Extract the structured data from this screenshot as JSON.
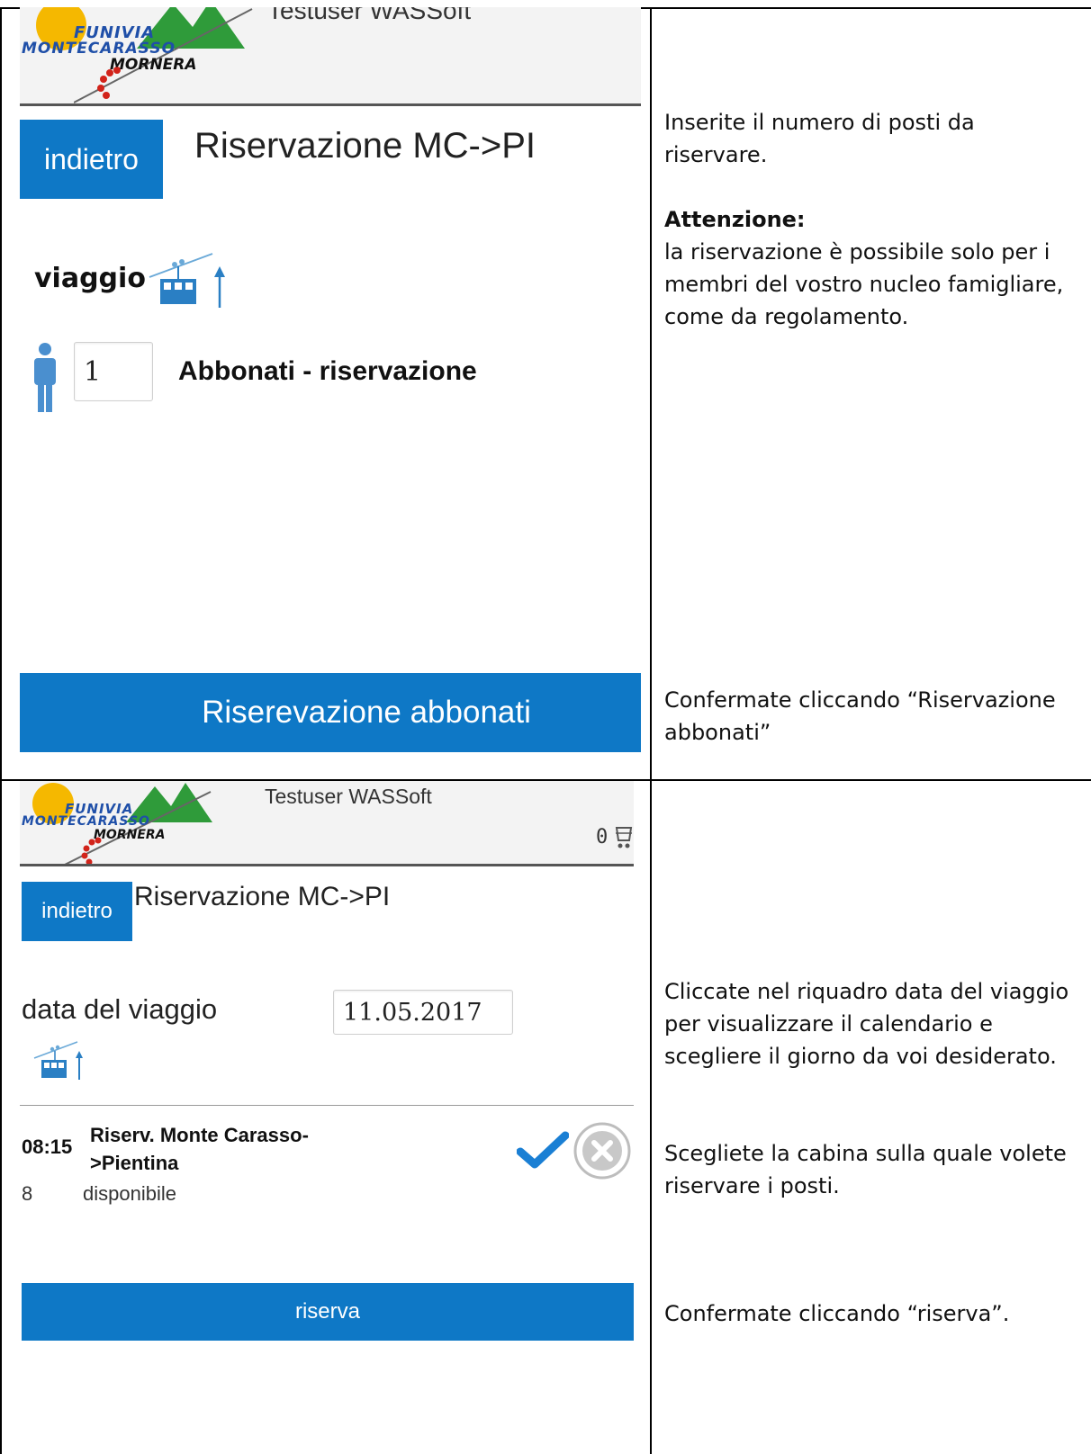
{
  "colors": {
    "brand_blue": "#0e78c6",
    "header_bg": "#f3f3f3",
    "logo_blue": "#1f4fa8",
    "logo_green": "#2f9b3a",
    "logo_yellow": "#f5b800",
    "logo_red": "#d2231a"
  },
  "panel1": {
    "header": {
      "user": "Testuser WASSoft",
      "logo_line1": "FUNIVIA",
      "logo_line2": "MONTECARASSO",
      "logo_line3": "MORNERA"
    },
    "back_label": "indietro",
    "title": "Riservazione MC->PI",
    "trip_label": "viaggio",
    "trip_icon": "cable-car-up-icon",
    "person_icon": "person-icon",
    "quantity": "1",
    "ticket_label": "Abbonati - riservazione",
    "confirm_label": "Riserevazione abbonati"
  },
  "note1": {
    "line1": "Inserite il numero di posti da riservare.",
    "attention_title": "Attenzione:",
    "attention_text": "la riservazione è possibile solo per i membri del vostro nucleo famigliare, come da regolamento.",
    "confirm": "Confermate cliccando “Riservazione abbonati”"
  },
  "panel2": {
    "header": {
      "user": "Testuser WASSoft",
      "cart_count": "0",
      "cart_icon": "cart-icon",
      "logo_line1": "FUNIVIA",
      "logo_line2": "MONTECARASSO",
      "logo_line3": "MORNERA"
    },
    "back_label": "indietro",
    "title": "Riservazione MC->PI",
    "date_label": "data del viaggio",
    "date_value": "11.05.2017",
    "trip_icon": "cable-car-up-icon",
    "row": {
      "time": "08:15",
      "name": "Riserv. Monte Carasso->Pientina",
      "seats": "8",
      "status": "disponibile",
      "check_icon": "check-icon",
      "cancel_icon": "close-circle-icon"
    },
    "reserve_label": "riserva"
  },
  "note2": {
    "date_hint": "Cliccate nel riquadro data del viaggio per visualizzare il calendario e scegliere il giorno da voi desiderato.",
    "cabin_hint": "Scegliete la cabina sulla quale volete riservare i posti.",
    "confirm": "Confermate cliccando “riserva”."
  }
}
